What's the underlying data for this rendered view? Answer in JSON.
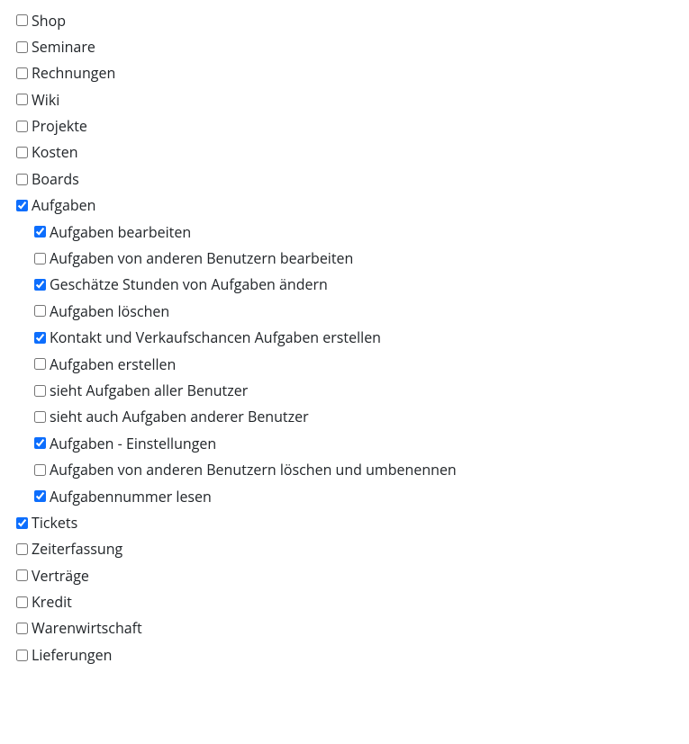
{
  "permissions": [
    {
      "id": "shop",
      "label": "Shop",
      "checked": false
    },
    {
      "id": "seminare",
      "label": "Seminare",
      "checked": false
    },
    {
      "id": "rechnungen",
      "label": "Rechnungen",
      "checked": false
    },
    {
      "id": "wiki",
      "label": "Wiki",
      "checked": false
    },
    {
      "id": "projekte",
      "label": "Projekte",
      "checked": false
    },
    {
      "id": "kosten",
      "label": "Kosten",
      "checked": false
    },
    {
      "id": "boards",
      "label": "Boards",
      "checked": false
    },
    {
      "id": "aufgaben",
      "label": "Aufgaben",
      "checked": true,
      "children": [
        {
          "id": "aufgaben-bearbeiten",
          "label": "Aufgaben bearbeiten",
          "checked": true
        },
        {
          "id": "aufgaben-andere-bearbeiten",
          "label": "Aufgaben von anderen Benutzern bearbeiten",
          "checked": false
        },
        {
          "id": "aufgaben-stunden-aendern",
          "label": "Geschätze Stunden von Aufgaben ändern",
          "checked": true
        },
        {
          "id": "aufgaben-loeschen",
          "label": "Aufgaben löschen",
          "checked": false
        },
        {
          "id": "aufgaben-kontakt-erstellen",
          "label": "Kontakt und Verkaufschancen Aufgaben erstellen",
          "checked": true
        },
        {
          "id": "aufgaben-erstellen",
          "label": "Aufgaben erstellen",
          "checked": false
        },
        {
          "id": "aufgaben-alle-sehen",
          "label": "sieht Aufgaben aller Benutzer",
          "checked": false
        },
        {
          "id": "aufgaben-andere-sehen",
          "label": "sieht auch Aufgaben anderer Benutzer",
          "checked": false
        },
        {
          "id": "aufgaben-einstellungen",
          "label": "Aufgaben - Einstellungen",
          "checked": true
        },
        {
          "id": "aufgaben-andere-loeschen",
          "label": "Aufgaben von anderen Benutzern löschen und umbenennen",
          "checked": false
        },
        {
          "id": "aufgabennummer-lesen",
          "label": "Aufgabennummer lesen",
          "checked": true
        }
      ]
    },
    {
      "id": "tickets",
      "label": "Tickets",
      "checked": true
    },
    {
      "id": "zeiterfassung",
      "label": "Zeiterfassung",
      "checked": false
    },
    {
      "id": "vertraege",
      "label": "Verträge",
      "checked": false
    },
    {
      "id": "kredit",
      "label": "Kredit",
      "checked": false
    },
    {
      "id": "warenwirtschaft",
      "label": "Warenwirtschaft",
      "checked": false
    },
    {
      "id": "lieferungen",
      "label": "Lieferungen",
      "checked": false
    }
  ]
}
